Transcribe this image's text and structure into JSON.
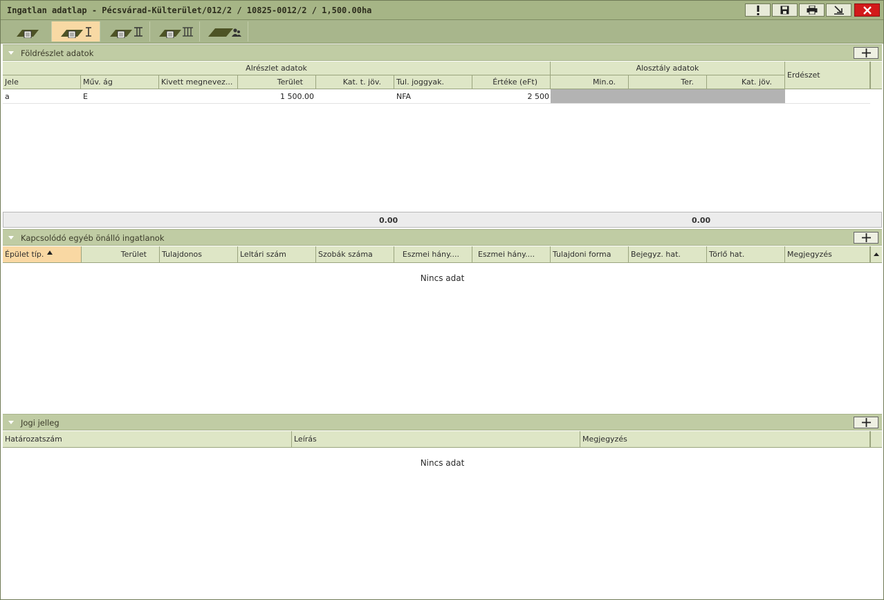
{
  "window": {
    "title": "Ingatlan adatlap - Pécsvárad-Külterület/012/2 / 10825-0012/2 / 1,500.00ha"
  },
  "title_buttons": [
    {
      "name": "alert-icon"
    },
    {
      "name": "save-icon"
    },
    {
      "name": "print-icon"
    },
    {
      "name": "minimize-arrow-icon"
    },
    {
      "name": "close-icon"
    }
  ],
  "toolbar": {
    "tabs": [
      {
        "name": "parcel-tab",
        "roman": "",
        "active": false
      },
      {
        "name": "parcel-part-1-tab",
        "roman": "I",
        "active": true
      },
      {
        "name": "parcel-part-2-tab",
        "roman": "II",
        "active": false
      },
      {
        "name": "parcel-part-3-tab",
        "roman": "III",
        "active": false
      },
      {
        "name": "parcel-owners-tab",
        "roman": "",
        "active": false
      }
    ]
  },
  "foldreszlet": {
    "header": "Földrészlet adatok",
    "group_alreszlet": "Alrészlet adatok",
    "group_alosztaly": "Alosztály adatok",
    "col_erdeszet": "Erdészet",
    "columns": [
      "Jele",
      "Műv. ág",
      "Kivett megnevez...",
      "Terület",
      "Kat. t. jöv.",
      "Tul. joggyak.",
      "Értéke (eFt)",
      "Min.o.",
      "Ter.",
      "Kat. jöv."
    ],
    "rows": [
      {
        "jele": "a",
        "muv_ag": "E",
        "kivett": "",
        "terulet": "1 500.00",
        "kat_t_jov": "",
        "tul_joggyak": "NFA",
        "erteke": "2 500"
      }
    ],
    "sum_terulet": "0.00",
    "sum_alosztaly": "0.00"
  },
  "kapcsolodo": {
    "header": "Kapcsolódó egyéb önálló ingatlanok",
    "columns": [
      "Épület típ.",
      "Terület",
      "Tulajdonos",
      "Leltári szám",
      "Szobák száma",
      "Eszmei hány....",
      "Eszmei hány....",
      "Tulajdoni forma",
      "Bejegyz. hat.",
      "Törlő hat.",
      "Megjegyzés"
    ],
    "empty_text": "Nincs adat"
  },
  "jogi": {
    "header": "Jogi jelleg",
    "columns": [
      "Határozatszám",
      "Leírás",
      "Megjegyzés"
    ],
    "empty_text": "Nincs adat"
  },
  "colors": {
    "titlebar": "#a6b586",
    "section_header": "#c0cca4",
    "column_header": "#dee6c6",
    "active_tab": "#f8d9a4",
    "close_button": "#d21a1a"
  }
}
